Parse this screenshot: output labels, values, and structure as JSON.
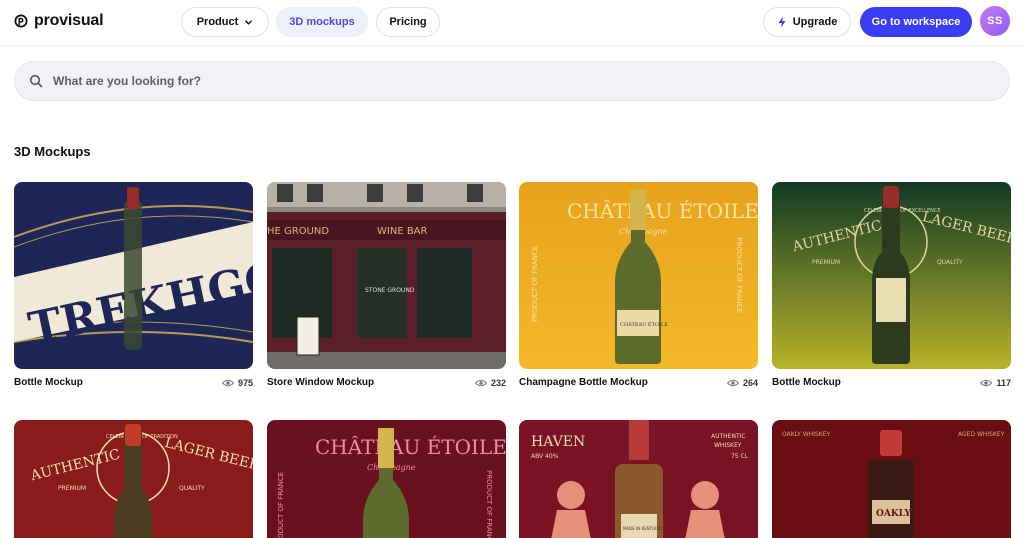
{
  "brand": {
    "name": "provisual"
  },
  "nav": {
    "product": "Product",
    "mockups": "3D mockups",
    "pricing": "Pricing"
  },
  "actions": {
    "upgrade": "Upgrade",
    "workspace": "Go to workspace",
    "avatar_initials": "SS"
  },
  "colors": {
    "accent": "#3b3df5",
    "active_tab_text": "#4a4ae6"
  },
  "search": {
    "placeholder": "What are you looking for?",
    "value": ""
  },
  "section": {
    "title": "3D Mockups"
  },
  "cards": [
    {
      "title": "Bottle Mockup",
      "views": "975",
      "art_text": "TREKHGORNOE"
    },
    {
      "title": "Store Window Mockup",
      "views": "232",
      "art_text_left": "HE GROUND",
      "art_text_right": "WINE BAR",
      "art_text_window": "STONE GROUND"
    },
    {
      "title": "Champagne Bottle Mockup",
      "views": "264",
      "art_text": "CHÂTEAU ÉTOILE",
      "art_sub": "Champagne",
      "art_side": "PRODUCT OF FRANCE",
      "art_label": "CHÂTEAU ÉTOILE"
    },
    {
      "title": "Bottle Mockup",
      "views": "117",
      "art_left": "AUTHENTIC",
      "art_right": "LAGER BEER",
      "art_left_sub": "PREMIUM",
      "art_right_sub": "QUALITY",
      "art_ring": "CELEBRATION OF EXCELLENCE"
    },
    {
      "art_left": "AUTHENTIC",
      "art_right": "LAGER BEER",
      "art_left_sub": "PREMIUM",
      "art_right_sub": "QUALITY",
      "art_ring": "CELEBRATION OF TRADITION"
    },
    {
      "art_text": "CHÂTEAU ÉTOILE",
      "art_sub": "Champagne",
      "art_side": "PRODUCT OF FRANCE"
    },
    {
      "art_left": "HAVEN",
      "art_left_sub": "ABV 40%",
      "art_right": "AUTHENTIC",
      "art_right2": "WHISKEY",
      "art_right_sub": "75 CL",
      "art_label": "MADE IN KENTUCKY"
    },
    {
      "art_left": "OAKLY WHISKEY",
      "art_right": "AGED WHISKEY",
      "art_label": "OAKLY"
    }
  ]
}
